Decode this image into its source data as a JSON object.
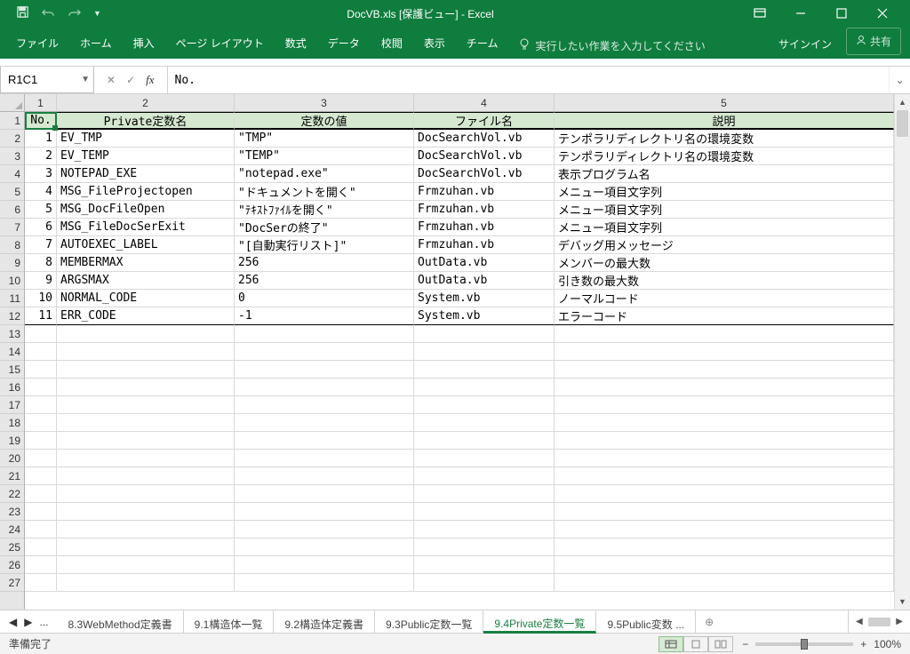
{
  "titlebar": {
    "title": "DocVB.xls  [保護ビュー] - Excel"
  },
  "ribbon": {
    "tabs": [
      "ファイル",
      "ホーム",
      "挿入",
      "ページ レイアウト",
      "数式",
      "データ",
      "校閲",
      "表示",
      "チーム"
    ],
    "tellme": "実行したい作業を入力してください",
    "signin": "サインイン",
    "share": "共有"
  },
  "fx": {
    "namebox": "R1C1",
    "formula": "No."
  },
  "columns": [
    "1",
    "2",
    "3",
    "4",
    "5"
  ],
  "header_row": [
    "No.",
    "Private定数名",
    "定数の値",
    "ファイル名",
    "説明"
  ],
  "rows": [
    {
      "no": "1",
      "name": "EV_TMP",
      "val": "\"TMP\"",
      "file": "DocSearchVol.vb",
      "desc": "テンポラリディレクトリ名の環境変数"
    },
    {
      "no": "2",
      "name": "EV_TEMP",
      "val": "\"TEMP\"",
      "file": "DocSearchVol.vb",
      "desc": "テンポラリディレクトリ名の環境変数"
    },
    {
      "no": "3",
      "name": "NOTEPAD_EXE",
      "val": "\"notepad.exe\"",
      "file": "DocSearchVol.vb",
      "desc": "表示プログラム名"
    },
    {
      "no": "4",
      "name": "MSG_FileProjectopen",
      "val": "\"ドキュメントを開く\"",
      "file": "Frmzuhan.vb",
      "desc": "メニュー項目文字列"
    },
    {
      "no": "5",
      "name": "MSG_DocFileOpen",
      "val": "\"ﾃｷｽﾄﾌｧｲﾙを開く\"",
      "file": "Frmzuhan.vb",
      "desc": "メニュー項目文字列"
    },
    {
      "no": "6",
      "name": "MSG_FileDocSerExit",
      "val": "\"DocSerの終了\"",
      "file": "Frmzuhan.vb",
      "desc": "メニュー項目文字列"
    },
    {
      "no": "7",
      "name": "AUTOEXEC_LABEL",
      "val": "\"[自動実行リスト]\"",
      "file": "Frmzuhan.vb",
      "desc": "デバッグ用メッセージ"
    },
    {
      "no": "8",
      "name": "MEMBERMAX",
      "val": "256",
      "file": "OutData.vb",
      "desc": "メンバーの最大数"
    },
    {
      "no": "9",
      "name": "ARGSMAX",
      "val": "256",
      "file": "OutData.vb",
      "desc": "引き数の最大数"
    },
    {
      "no": "10",
      "name": "NORMAL_CODE",
      "val": "0",
      "file": "System.vb",
      "desc": "ノーマルコード"
    },
    {
      "no": "11",
      "name": "ERR_CODE",
      "val": "-1",
      "file": "System.vb",
      "desc": "エラーコード"
    }
  ],
  "row_numbers_total": 27,
  "sheet_tabs": {
    "more": "...",
    "tabs": [
      {
        "label": "8.3WebMethod定義書",
        "active": false
      },
      {
        "label": "9.1構造体一覧",
        "active": false
      },
      {
        "label": "9.2構造体定義書",
        "active": false
      },
      {
        "label": "9.3Public定数一覧",
        "active": false
      },
      {
        "label": "9.4Private定数一覧",
        "active": true
      },
      {
        "label": "9.5Public変数 ...",
        "active": false
      }
    ]
  },
  "status": {
    "ready": "準備完了",
    "zoom": "100%"
  }
}
